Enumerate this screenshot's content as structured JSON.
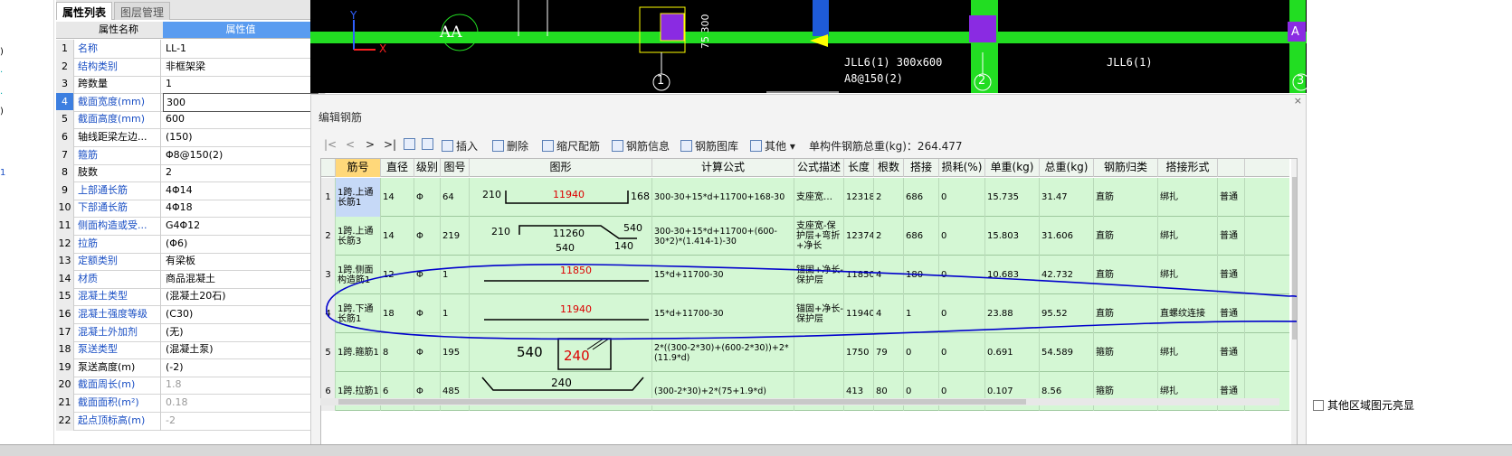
{
  "tabs": [
    "属性列表",
    "图层管理"
  ],
  "prop_header": {
    "name": "属性名称",
    "value": "属性值"
  },
  "props": [
    {
      "n": "1",
      "name": "名称",
      "value": "LL-1",
      "blue": true
    },
    {
      "n": "2",
      "name": "结构类别",
      "value": "非框架梁",
      "blue": true
    },
    {
      "n": "3",
      "name": "跨数量",
      "value": "1",
      "blue": false
    },
    {
      "n": "4",
      "name": "截面宽度(mm)",
      "value": "300",
      "blue": true
    },
    {
      "n": "5",
      "name": "截面高度(mm)",
      "value": "600",
      "blue": true
    },
    {
      "n": "6",
      "name": "轴线距梁左边...",
      "value": "(150)",
      "blue": false
    },
    {
      "n": "7",
      "name": "箍筋",
      "value": "Φ8@150(2)",
      "blue": true
    },
    {
      "n": "8",
      "name": "肢数",
      "value": "2",
      "blue": false
    },
    {
      "n": "9",
      "name": "上部通长筋",
      "value": "4Φ14",
      "blue": true
    },
    {
      "n": "10",
      "name": "下部通长筋",
      "value": "4Φ18",
      "blue": true
    },
    {
      "n": "11",
      "name": "侧面构造或受...",
      "value": "G4Φ12",
      "blue": true
    },
    {
      "n": "12",
      "name": "拉筋",
      "value": "(Φ6)",
      "blue": true
    },
    {
      "n": "13",
      "name": "定额类别",
      "value": "有梁板",
      "blue": true
    },
    {
      "n": "14",
      "name": "材质",
      "value": "商品混凝土",
      "blue": true
    },
    {
      "n": "15",
      "name": "混凝土类型",
      "value": "(混凝土20石)",
      "blue": true
    },
    {
      "n": "16",
      "name": "混凝土强度等级",
      "value": "(C30)",
      "blue": true
    },
    {
      "n": "17",
      "name": "混凝土外加剂",
      "value": "(无)",
      "blue": true
    },
    {
      "n": "18",
      "name": "泵送类型",
      "value": "(混凝土泵)",
      "blue": true
    },
    {
      "n": "19",
      "name": "泵送高度(m)",
      "value": "(-2)",
      "blue": false
    },
    {
      "n": "20",
      "name": "截面周长(m)",
      "value": "1.8",
      "blue": true
    },
    {
      "n": "21",
      "name": "截面面积(m²)",
      "value": "0.18",
      "blue": true
    },
    {
      "n": "22",
      "name": "起点顶标高(m)",
      "value": "-2",
      "blue": true
    }
  ],
  "left_strip": [
    ")",
    ".",
    ".",
    ")",
    "1"
  ],
  "canvas": {
    "axis_y": "Y",
    "axis_x": "X",
    "circle_label": "AA",
    "grid_labels": [
      "1",
      "2",
      "3"
    ],
    "dim": "75  300",
    "beam_texts": [
      "JLL6(1) 300x600",
      "A8@150(2)",
      "JLL6(1)",
      "A"
    ]
  },
  "edit_panel": {
    "title": "编辑钢筋",
    "close": "×",
    "nav": [
      "|<",
      "<",
      ">",
      ">|"
    ],
    "insert": "插入",
    "delete": "删除",
    "scale": "缩尺配筋",
    "info": "钢筋信息",
    "lib": "钢筋图库",
    "other": "其他",
    "total": "单构件钢筋总重(kg)：264.477"
  },
  "grid_headers": [
    "筋号",
    "直径(mm)",
    "级别",
    "图号",
    "图形",
    "计算公式",
    "公式描述",
    "长度",
    "根数",
    "搭接",
    "损耗(%)",
    "单重(kg)",
    "总重(kg)",
    "钢筋归类",
    "搭接形式",
    ""
  ],
  "rows": [
    {
      "rn": "1",
      "name": "1跨.上通长筋1",
      "d": "14",
      "lv": "Φ",
      "fig": "64",
      "formula": "300-30+15*d+11700+168-30",
      "desc": "支座宽…",
      "len": "12318",
      "cnt": "2",
      "lap": "686",
      "loss": "0",
      "unit": "15.735",
      "total": "31.47",
      "cat": "直筋",
      "lapf": "绑扎",
      "last": "普通",
      "shape": {
        "a": "210",
        "b": "11940",
        "c": "168"
      }
    },
    {
      "rn": "2",
      "name": "1跨.上通长筋3",
      "d": "14",
      "lv": "Φ",
      "fig": "219",
      "formula": "300-30+15*d+11700+(600-30*2)*(1.414-1)-30",
      "desc": "支座宽-保护层+弯折+净长",
      "len": "12374",
      "cnt": "2",
      "lap": "686",
      "loss": "0",
      "unit": "15.803",
      "total": "31.606",
      "cat": "直筋",
      "lapf": "绑扎",
      "last": "普通",
      "shape": {
        "a": "210",
        "b": "11260",
        "c": "540",
        "d": "540",
        "e": "140"
      }
    },
    {
      "rn": "3",
      "name": "1跨.侧面构造筋1",
      "d": "12",
      "lv": "Φ",
      "fig": "1",
      "formula": "15*d+11700-30",
      "desc": "锚固+净长-保护层",
      "len": "11850",
      "cnt": "4",
      "lap": "180",
      "loss": "0",
      "unit": "10.683",
      "total": "42.732",
      "cat": "直筋",
      "lapf": "绑扎",
      "last": "普通",
      "shape": {
        "b": "11850"
      }
    },
    {
      "rn": "4",
      "name": "1跨.下通长筋1",
      "d": "18",
      "lv": "Φ",
      "fig": "1",
      "formula": "15*d+11700-30",
      "desc": "锚固+净长-保护层",
      "len": "11940",
      "cnt": "4",
      "lap": "1",
      "loss": "0",
      "unit": "23.88",
      "total": "95.52",
      "cat": "直筋",
      "lapf": "直螺纹连接",
      "last": "普通",
      "shape": {
        "b": "11940"
      }
    },
    {
      "rn": "5",
      "name": "1跨.箍筋1",
      "d": "8",
      "lv": "Φ",
      "fig": "195",
      "formula": "2*((300-2*30)+(600-2*30))+2*(11.9*d)",
      "desc": "",
      "len": "1750",
      "cnt": "79",
      "lap": "0",
      "loss": "0",
      "unit": "0.691",
      "total": "54.589",
      "cat": "箍筋",
      "lapf": "绑扎",
      "last": "普通",
      "shape": {
        "a": "540",
        "b": "240"
      }
    },
    {
      "rn": "6",
      "name": "1跨.拉筋1",
      "d": "6",
      "lv": "Φ",
      "fig": "485",
      "formula": "(300-2*30)+2*(75+1.9*d)",
      "desc": "",
      "len": "413",
      "cnt": "80",
      "lap": "0",
      "loss": "0",
      "unit": "0.107",
      "total": "8.56",
      "cat": "箍筋",
      "lapf": "绑扎",
      "last": "普通",
      "shape": {
        "b": "240"
      }
    }
  ],
  "right_panel": {
    "checkbox": "其他区域图元亮显"
  },
  "colors": {
    "accent": "#3d7fe0",
    "row_bg": "#d4f7d4",
    "canvas_bg": "#000000",
    "beam": "#22dd22",
    "column": "#8a2be2",
    "annot": "#0000cc"
  }
}
